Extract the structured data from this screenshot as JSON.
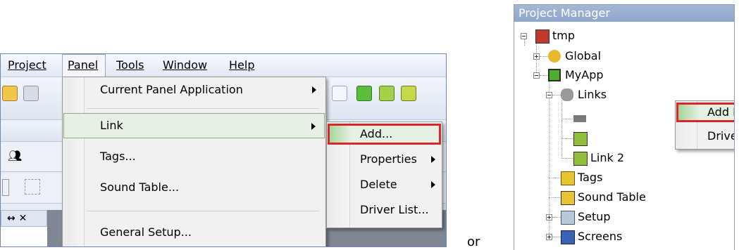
{
  "menubar": {
    "items": [
      {
        "label": "Project",
        "underline": "P"
      },
      {
        "label": "Panel",
        "underline": "a"
      },
      {
        "label": "Tools",
        "underline": "T"
      },
      {
        "label": "Window",
        "underline": "W"
      },
      {
        "label": "Help",
        "underline": "H"
      }
    ]
  },
  "panel_menu": {
    "items": [
      {
        "label": "Current Panel Application",
        "has_submenu": true
      },
      {
        "label": "Link",
        "has_submenu": true,
        "highlighted": true
      },
      {
        "label": "Tags...",
        "has_submenu": false
      },
      {
        "label": "Sound Table...",
        "has_submenu": false
      },
      {
        "label": "General Setup...",
        "has_submenu": false
      }
    ]
  },
  "link_submenu": {
    "items": [
      {
        "label": "Add...",
        "highlighted": true
      },
      {
        "label": "Properties",
        "has_submenu": true
      },
      {
        "label": "Delete",
        "has_submenu": true
      },
      {
        "label": "Driver List..."
      }
    ]
  },
  "separator_text": "or",
  "project_manager": {
    "title": "Project Manager",
    "tree": [
      {
        "label": "tmp"
      },
      {
        "label": "Global"
      },
      {
        "label": "MyApp"
      },
      {
        "label": "Links"
      },
      {
        "label": "Link 2"
      },
      {
        "label": "Tags"
      },
      {
        "label": "Sound Table"
      },
      {
        "label": "Setup"
      },
      {
        "label": "Screens"
      }
    ],
    "context_menu": [
      {
        "label": "Add Link...",
        "highlighted": true
      },
      {
        "label": "Driver List..."
      }
    ]
  },
  "colors": {
    "highlight_border": "#d9262a",
    "highlight_fill": "#e6f0e3",
    "title_bar": "#9bb1d3"
  }
}
